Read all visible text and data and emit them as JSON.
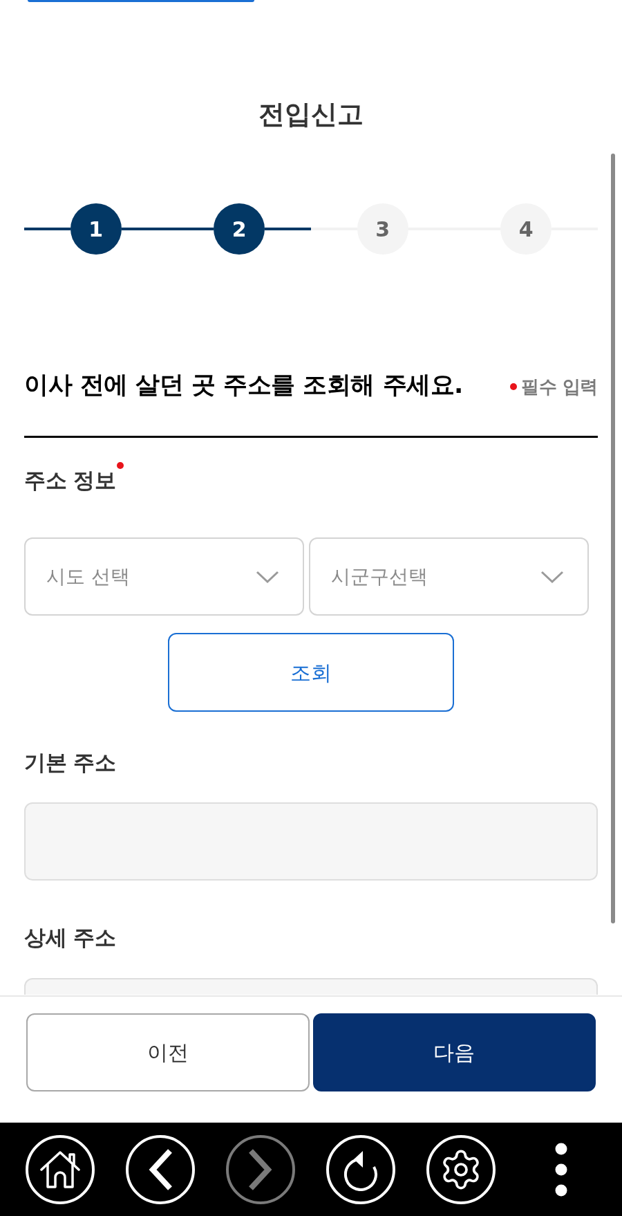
{
  "page": {
    "title": "전입신고"
  },
  "steps": [
    {
      "label": "1",
      "done": true
    },
    {
      "label": "2",
      "done": true
    },
    {
      "label": "3",
      "done": false
    },
    {
      "label": "4",
      "done": false
    }
  ],
  "section": {
    "heading": "이사 전에 살던 곳 주소를 조회해 주세요.",
    "required_note": "필수 입력"
  },
  "address_info": {
    "label": "주소 정보",
    "required": true,
    "selects": [
      {
        "placeholder": "시도 선택"
      },
      {
        "placeholder": "시군구선택"
      }
    ],
    "search_button": "조회"
  },
  "fields": [
    {
      "label": "기본 주소",
      "required": false
    },
    {
      "label": "상세 주소",
      "required": false
    }
  ],
  "footer_buttons": [
    {
      "label": "이전",
      "kind": "secondary"
    },
    {
      "label": "다음",
      "kind": "primary"
    }
  ],
  "nav_bar": [
    {
      "kind": "home",
      "disabled": false
    },
    {
      "kind": "back",
      "disabled": false
    },
    {
      "kind": "forward",
      "disabled": true
    },
    {
      "kind": "reload",
      "disabled": false
    },
    {
      "kind": "settings",
      "disabled": false
    },
    {
      "kind": "more",
      "disabled": false
    }
  ]
}
